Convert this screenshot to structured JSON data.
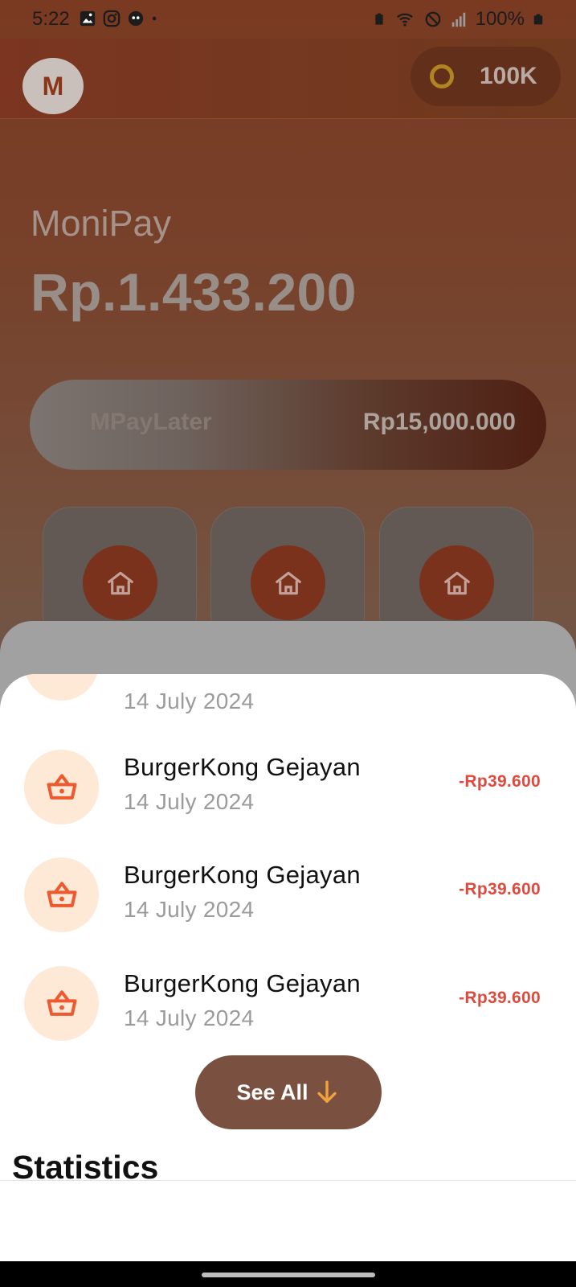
{
  "status_bar": {
    "time": "5:22",
    "battery": "100%"
  },
  "header": {
    "avatar_initial": "M",
    "coins": "100K"
  },
  "wallet": {
    "name": "MoniPay",
    "balance": "Rp.1.433.200"
  },
  "paylater": {
    "label": "MPayLater",
    "amount": "Rp15,000.000"
  },
  "menu": {
    "items": [
      {
        "icon": "home-icon"
      },
      {
        "icon": "home-icon"
      },
      {
        "icon": "home-icon"
      }
    ]
  },
  "transactions": {
    "partial_date": "14 July 2024",
    "items": [
      {
        "name": "BurgerKong Gejayan",
        "date": "14 July 2024",
        "amount": "-Rp39.600",
        "icon": "basket-icon"
      },
      {
        "name": "BurgerKong Gejayan",
        "date": "14 July 2024",
        "amount": "-Rp39.600",
        "icon": "basket-icon"
      },
      {
        "name": "BurgerKong Gejayan",
        "date": "14 July 2024",
        "amount": "-Rp39.600",
        "icon": "basket-icon"
      }
    ],
    "see_all_label": "See All"
  },
  "statistics": {
    "title": "Statistics"
  },
  "colors": {
    "accent": "#7a321d",
    "negative_amount": "#de4b3e",
    "see_all_button": "#7a5140",
    "arrow": "#f2a23a"
  }
}
